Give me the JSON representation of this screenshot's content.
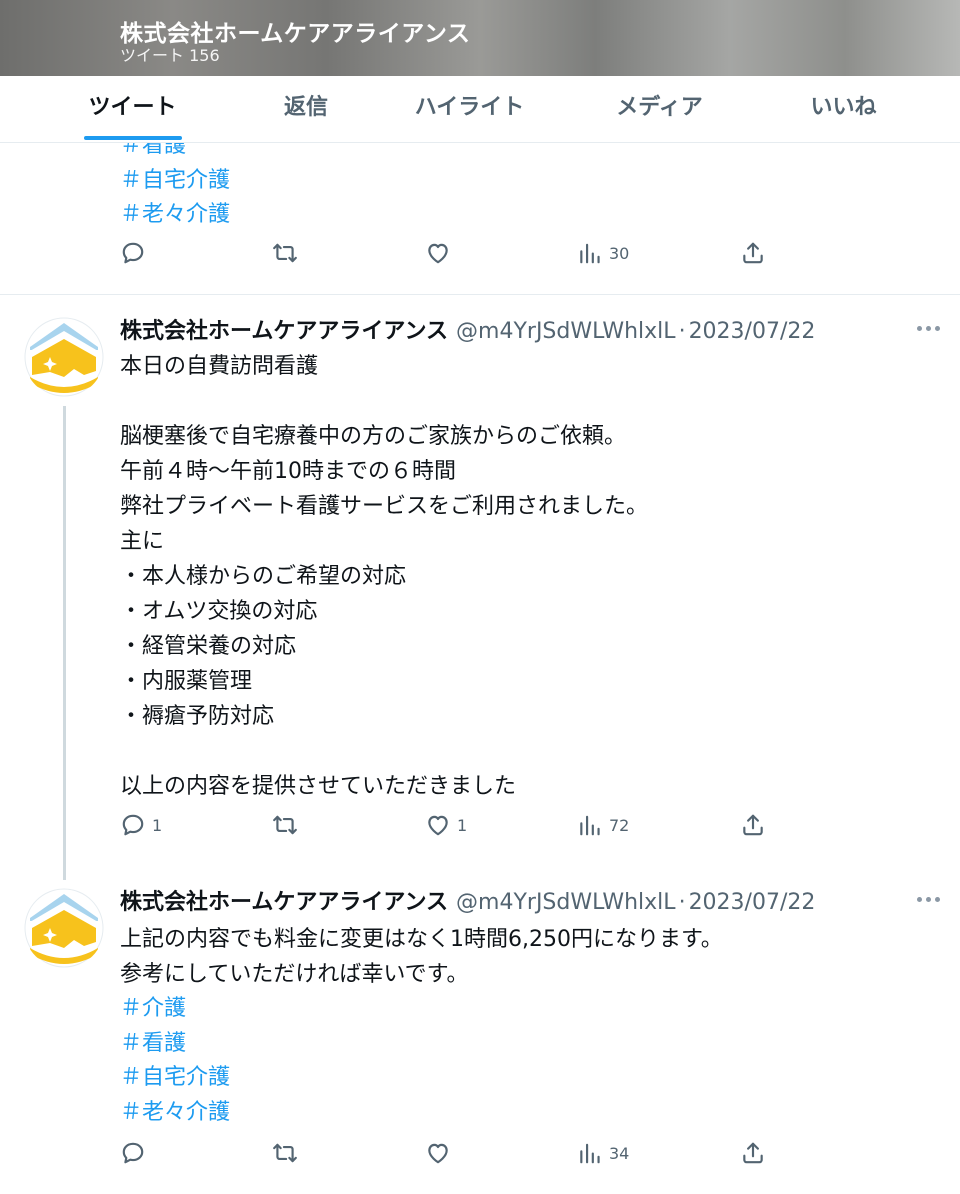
{
  "header": {
    "title": "株式会社ホームケアアライアンス",
    "subtitle": "ツイート 156"
  },
  "tabs": [
    {
      "label": "ツイート",
      "active": true
    },
    {
      "label": "返信",
      "active": false
    },
    {
      "label": "ハイライト",
      "active": false
    },
    {
      "label": "メディア",
      "active": false
    },
    {
      "label": "いいね",
      "active": false
    }
  ],
  "tweets": [
    {
      "hashtags": [
        "＃看護",
        "＃自宅介護",
        "＃老々介護"
      ],
      "stats": {
        "replies": "",
        "retweets": "",
        "likes": "",
        "views": "30"
      }
    },
    {
      "author": "株式会社ホームケアアライアンス",
      "handle": "@m4YrJSdWLWhlxlL",
      "separator": "·",
      "date": "2023/07/22",
      "text": "本日の自費訪問看護\n\n脳梗塞後で自宅療養中の方のご家族からのご依頼。\n午前４時〜午前10時までの６時間\n弊社プライベート看護サービスをご利用されました。\n主に\n・本人様からのご希望の対応\n・オムツ交換の対応\n・経管栄養の対応\n・内服薬管理\n・褥瘡予防対応\n\n以上の内容を提供させていただきました",
      "stats": {
        "replies": "1",
        "retweets": "",
        "likes": "1",
        "views": "72"
      }
    },
    {
      "author": "株式会社ホームケアアライアンス",
      "handle": "@m4YrJSdWLWhlxlL",
      "separator": "·",
      "date": "2023/07/22",
      "text": "上記の内容でも料金に変更はなく1時間6,250円になります。\n参考にしていただければ幸いです。",
      "hashtags": [
        "＃介護",
        "＃看護",
        "＃自宅介護",
        "＃老々介護"
      ],
      "stats": {
        "replies": "",
        "retweets": "",
        "likes": "",
        "views": "34"
      }
    }
  ],
  "colors": {
    "accent": "#1d9bf0",
    "text": "#0f1419",
    "secondary": "#536471",
    "avatar_yellow": "#f7c21c"
  },
  "icons": [
    "reply-icon",
    "retweet-icon",
    "like-icon",
    "views-icon",
    "share-icon",
    "more-icon"
  ]
}
